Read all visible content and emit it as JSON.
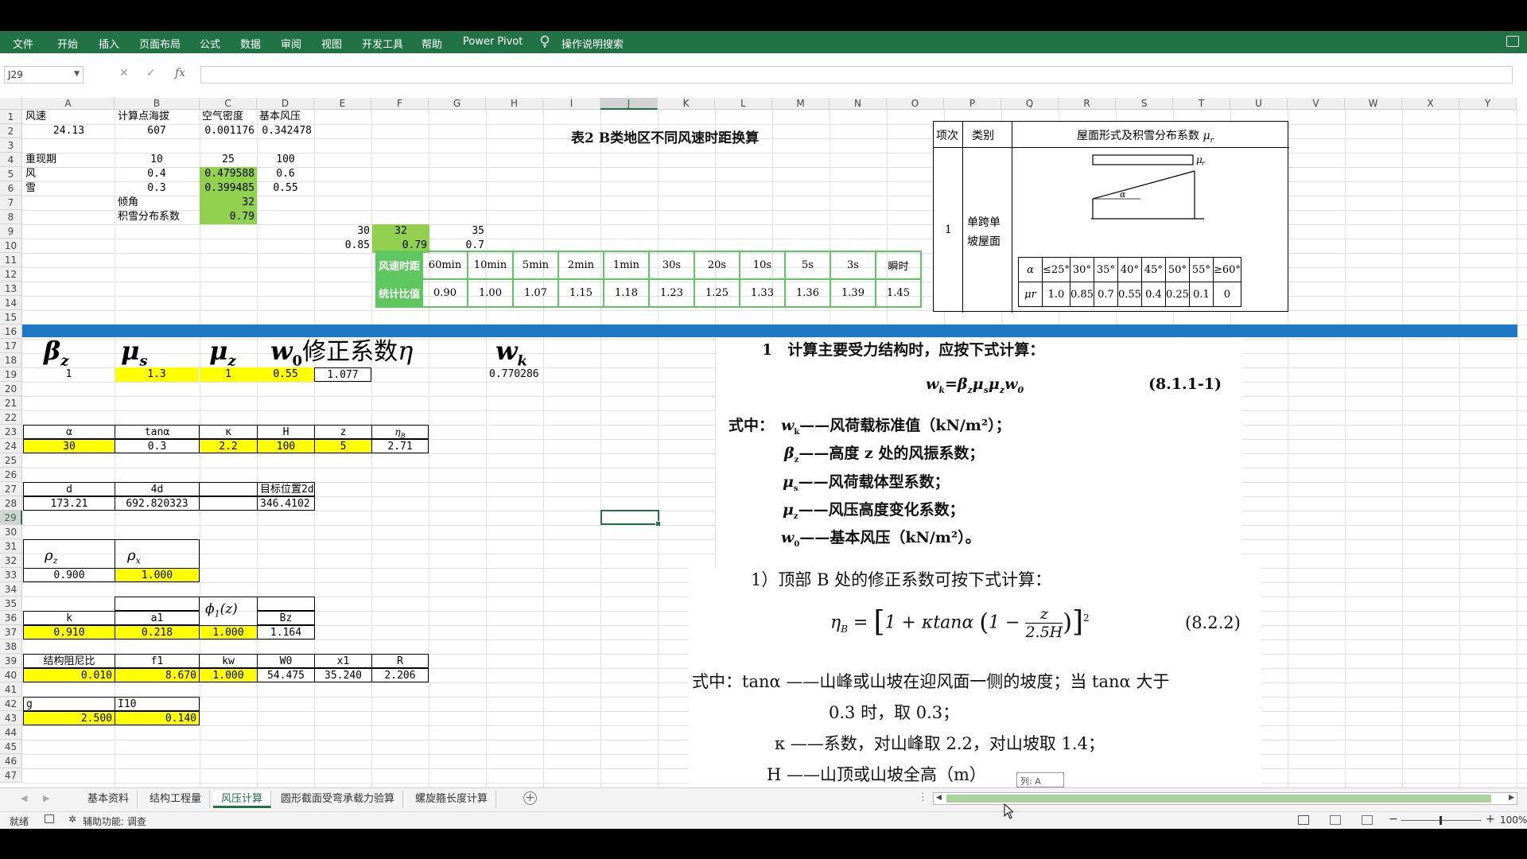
{
  "ribbon": {
    "tabs": [
      "文件",
      "开始",
      "插入",
      "页面布局",
      "公式",
      "数据",
      "审阅",
      "视图",
      "开发工具",
      "帮助",
      "Power Pivot"
    ],
    "search": "操作说明搜索"
  },
  "formula_bar": {
    "name_box": "J29",
    "formula": ""
  },
  "columns": [
    "A",
    "B",
    "C",
    "D",
    "E",
    "F",
    "G",
    "H",
    "I",
    "J",
    "K",
    "L",
    "M",
    "N",
    "O",
    "P",
    "Q",
    "R",
    "S",
    "T",
    "U",
    "V",
    "W",
    "X",
    "Y"
  ],
  "rows": [
    "1",
    "2",
    "3",
    "4",
    "5",
    "6",
    "7",
    "8",
    "9",
    "10",
    "11",
    "12",
    "13",
    "14",
    "15",
    "16",
    "17",
    "18",
    "19",
    "20",
    "21",
    "22",
    "23",
    "24",
    "25",
    "26",
    "27",
    "28",
    "29",
    "30",
    "31",
    "32",
    "33",
    "34",
    "35",
    "36",
    "37",
    "38",
    "39",
    "40",
    "41",
    "42",
    "43",
    "44",
    "45",
    "46",
    "47"
  ],
  "cells": {
    "a1": "风速",
    "b1": "计算点海拔",
    "c1": "空气密度",
    "d1": "基本风压",
    "a2": "24.13",
    "b2": "607",
    "c2": "0.001176",
    "d2": "0.342478",
    "a4": "重现期",
    "b4": "10",
    "c4": "25",
    "d4": "100",
    "a5": "风",
    "b5": "0.4",
    "c5": "0.479588",
    "d5": "0.6",
    "a6": "雪",
    "b6": "0.3",
    "c6": "0.399485",
    "d6": "0.55",
    "b7": "倾角",
    "c7": "32",
    "b8": "积雪分布系数",
    "c8": "0.79",
    "e9": "30",
    "f9": "32",
    "g9": "35",
    "e10": "0.85",
    "f10": "0.79",
    "g10": "0.7",
    "a19": "1",
    "b19": "1.3",
    "c19": "1",
    "d19": "0.55",
    "e19": "1.077",
    "i19": "0.770286",
    "a23": "α",
    "b23": "tanα",
    "c23": "κ",
    "d23": "H",
    "e23": "z",
    "a24": "30",
    "b24": "0.3",
    "c24": "2.2",
    "d24": "100",
    "e24": "5",
    "f24": "2.71",
    "a27": "d",
    "b27": "4d",
    "d27": "目标位置2d",
    "a28": "173.21",
    "b28": "692.820323",
    "d28": "346.4102",
    "a33": "0.900",
    "b33": "1.000",
    "a36": "k",
    "b36": "a1",
    "d36": "Bz",
    "a37": "0.910",
    "b37": "0.218",
    "c37": "1.000",
    "d37": "1.164",
    "a39": "结构阻尼比",
    "b39": "f1",
    "c39": "kw",
    "d39": "W0",
    "e39": "x1",
    "f39": "R",
    "a40": "0.010",
    "b40": "8.670",
    "c40": "1.000",
    "d40": "54.475",
    "e40": "35.240",
    "f40": "2.206",
    "a42": "g",
    "b42": "I10",
    "a43": "2.500",
    "b43": "0.140"
  },
  "big_headers": {
    "eta_label": "修正系数"
  },
  "wind_table": {
    "title": "表2 B类地区不同风速时距换算",
    "row1_label": "风速时距",
    "row2_label": "统计比值",
    "durations": [
      "60min",
      "10min",
      "5min",
      "2min",
      "1min",
      "30s",
      "20s",
      "10s",
      "5s",
      "3s",
      "瞬时"
    ],
    "ratios": [
      "0.90",
      "1.00",
      "1.07",
      "1.15",
      "1.18",
      "1.23",
      "1.25",
      "1.33",
      "1.36",
      "1.39",
      "1.45"
    ]
  },
  "snow_table": {
    "col1": "项次",
    "col2": "类别",
    "col3": "屋面形式及积雪分布系数",
    "item": "1",
    "category": "单跨单坡屋面",
    "alpha_label": "α",
    "mu_label": "μr",
    "angles": [
      "≤25°",
      "30°",
      "35°",
      "40°",
      "45°",
      "50°",
      "55°",
      "≥60°"
    ],
    "values": [
      "1.0",
      "0.85",
      "0.7",
      "0.55",
      "0.4",
      "0.25",
      "0.1",
      "0"
    ]
  },
  "formula_text": {
    "p1": "1　计算主要受力结构时，应按下式计算：",
    "eq1": "(8.1.1-1)",
    "l1": "——风荷载标准值（kN/m²）；",
    "l2": "——高度 z 处的风振系数；",
    "l3": "——风荷载体型系数；",
    "l4": "——风压高度变化系数；",
    "l5": "——基本风压（kN/m²）。",
    "shizhong": "式中：",
    "p2": "1）顶部 B 处的修正系数可按下式计算：",
    "eq2": "(8.2.2)",
    "p3": "式中：tanα ——山峰或山坡在迎风面一侧的坡度；当 tanα 大于",
    "p4": "0.3 时，取 0.3；",
    "p5": "κ ——系数，对山峰取 2.2，对山坡取 1.4；",
    "p6": "H ——山顶或山坡全高（m）"
  },
  "sheets": [
    "基本资料",
    "结构工程量",
    "风压计算",
    "圆形截面受弯承载力验算",
    "螺旋箍长度计算"
  ],
  "active_sheet": "风压计算",
  "status": {
    "ready": "就绪",
    "accessibility": "辅助功能: 调查",
    "zoom": "100%"
  },
  "tooltip": "列: A",
  "accent": "#217346"
}
